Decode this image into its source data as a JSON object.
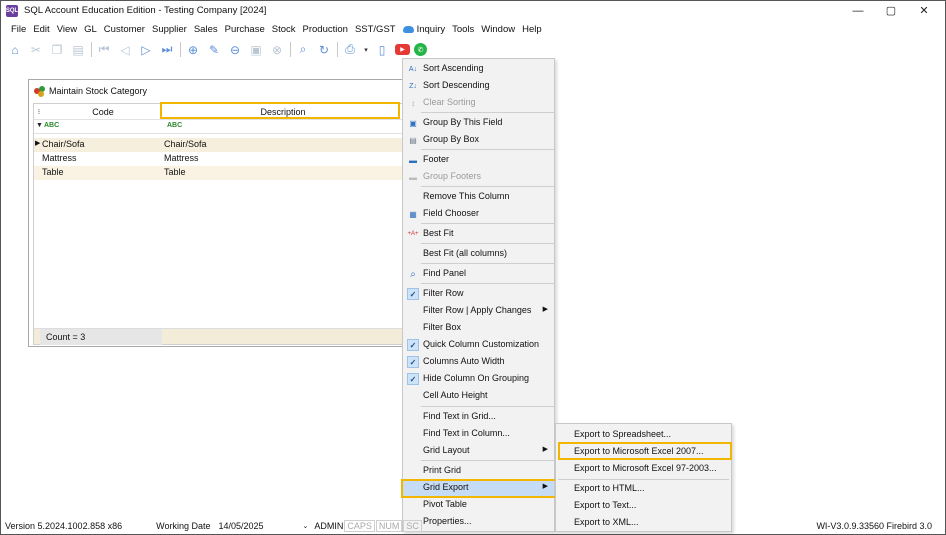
{
  "window": {
    "title": "SQL Account Education Edition - Testing Company [2024]",
    "app_icon_text": "SQL",
    "controls": [
      "—",
      "▢",
      "✕"
    ]
  },
  "menubar": {
    "items": [
      "File",
      "Edit",
      "View",
      "GL",
      "Customer",
      "Supplier",
      "Sales",
      "Purchase",
      "Stock",
      "Production",
      "SST/GST",
      "Inquiry",
      "Tools",
      "Window",
      "Help"
    ]
  },
  "child_window": {
    "title": "Maintain Stock Category",
    "columns": {
      "code": "Code",
      "description": "Description"
    },
    "filter_icon": "ABC",
    "rows": [
      {
        "code": "Chair/Sofa",
        "description": "Chair/Sofa"
      },
      {
        "code": "Mattress",
        "description": "Mattress"
      },
      {
        "code": "Table",
        "description": "Table"
      }
    ],
    "count_label": "Count = 3"
  },
  "context_menu": {
    "items": [
      {
        "label": "Sort Ascending",
        "icon": "sort-asc-icon",
        "glyph": "A↓",
        "disabled": false
      },
      {
        "label": "Sort Descending",
        "icon": "sort-desc-icon",
        "glyph": "Z↓",
        "disabled": false
      },
      {
        "label": "Clear Sorting",
        "icon": "clear-sort-icon",
        "glyph": "↕",
        "disabled": true
      },
      {
        "label": "Group By This Field",
        "icon": "group-field-icon",
        "glyph": "▣",
        "disabled": false
      },
      {
        "label": "Group By Box",
        "icon": "group-box-icon",
        "glyph": "▤",
        "disabled": false
      },
      {
        "label": "Footer",
        "icon": "footer-icon",
        "glyph": "▬",
        "disabled": false
      },
      {
        "label": "Group Footers",
        "icon": "group-footers-icon",
        "glyph": "▬",
        "disabled": true
      },
      {
        "label": "Remove This Column",
        "icon": "",
        "glyph": "",
        "disabled": false
      },
      {
        "label": "Field Chooser",
        "icon": "field-chooser-icon",
        "glyph": "▦",
        "disabled": false
      },
      {
        "label": "Best Fit",
        "icon": "best-fit-icon",
        "glyph": "+A+",
        "disabled": false
      },
      {
        "label": "Best Fit (all columns)",
        "icon": "",
        "glyph": "",
        "disabled": false
      },
      {
        "label": "Find Panel",
        "icon": "search-icon",
        "glyph": "⌕",
        "disabled": false
      },
      {
        "label": "Filter Row",
        "icon": "check-icon",
        "glyph": "✓",
        "disabled": false
      },
      {
        "label": "Filter Row | Apply Changes",
        "icon": "",
        "glyph": "",
        "disabled": false,
        "submenu": true
      },
      {
        "label": "Filter Box",
        "icon": "",
        "glyph": "",
        "disabled": false
      },
      {
        "label": "Quick Column Customization",
        "icon": "check-icon",
        "glyph": "✓",
        "disabled": false
      },
      {
        "label": "Columns Auto Width",
        "icon": "check-icon",
        "glyph": "✓",
        "disabled": false
      },
      {
        "label": "Hide Column On Grouping",
        "icon": "check-icon",
        "glyph": "✓",
        "disabled": false
      },
      {
        "label": "Cell Auto Height",
        "icon": "",
        "glyph": "",
        "disabled": false
      },
      {
        "label": "Find Text in Grid...",
        "icon": "",
        "glyph": "",
        "disabled": false
      },
      {
        "label": "Find Text in Column...",
        "icon": "",
        "glyph": "",
        "disabled": false
      },
      {
        "label": "Grid Layout",
        "icon": "",
        "glyph": "",
        "disabled": false,
        "submenu": true
      },
      {
        "label": "Print Grid",
        "icon": "",
        "glyph": "",
        "disabled": false
      },
      {
        "label": "Grid Export",
        "icon": "",
        "glyph": "",
        "disabled": false,
        "submenu": true,
        "active": true
      },
      {
        "label": "Pivot Table",
        "icon": "",
        "glyph": "",
        "disabled": false
      },
      {
        "label": "Properties...",
        "icon": "",
        "glyph": "",
        "disabled": false
      }
    ]
  },
  "export_submenu": {
    "items": [
      "Export to Spreadsheet...",
      "Export to Microsoft Excel 2007...",
      "Export to Microsoft Excel 97-2003...",
      "Export to HTML...",
      "Export to Text...",
      "Export to XML..."
    ]
  },
  "statusbar": {
    "version": "Version 5.2024.1002.858 x86",
    "working_date_label": "Working Date",
    "working_date": "14/05/2025",
    "user": "ADMIN",
    "caps": "CAPS",
    "num": "NUM",
    "sc": "SC",
    "build": "WI-V3.0.9.33560 Firebird 3.0"
  },
  "colors": {
    "highlight": "#f2b600",
    "selected_row": "#f7efdd",
    "menu_bg": "#f2f2f2",
    "check_bg": "#cde3f7"
  }
}
